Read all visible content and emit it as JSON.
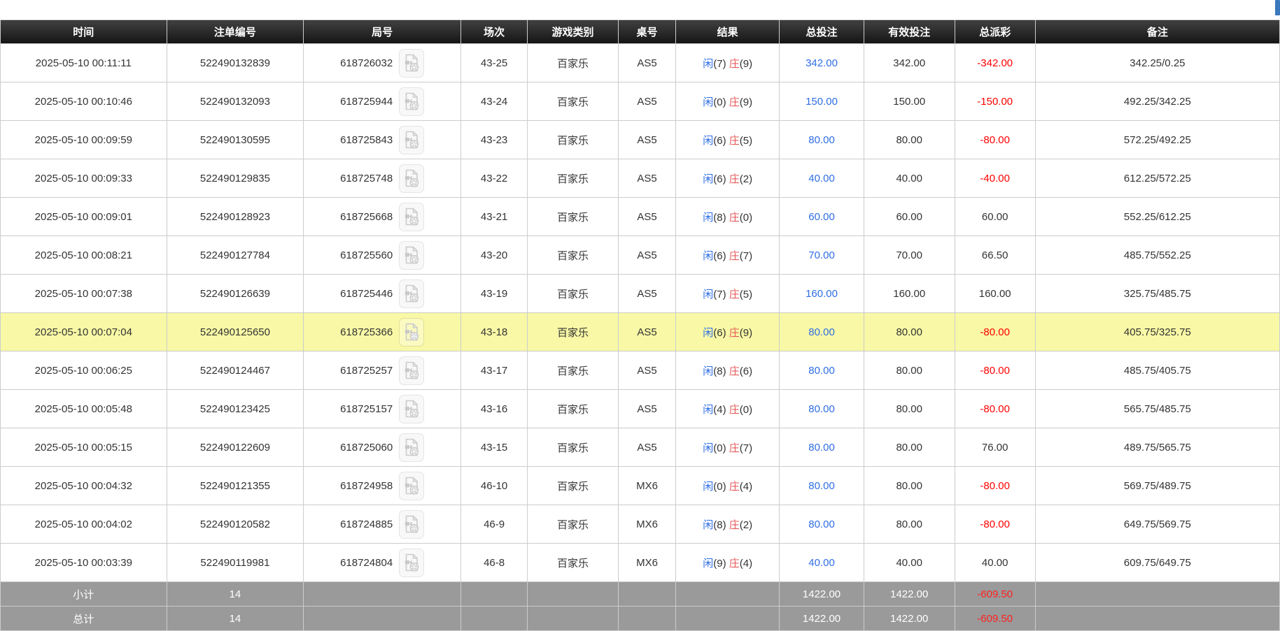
{
  "page": {
    "scrollbar_thumb_color": "#3a79bd",
    "highlight_color": "#f8f8a6",
    "header_bg": "#1a1a1a",
    "footer_bg": "#9a9a9a",
    "blue": "#2e6ee4",
    "banker_red": "#e45b5b",
    "negative_red": "#ff0000"
  },
  "table": {
    "columns": [
      {
        "id": "time",
        "label": "时间"
      },
      {
        "id": "bet-id",
        "label": "注单编号"
      },
      {
        "id": "round",
        "label": "局号"
      },
      {
        "id": "session",
        "label": "场次"
      },
      {
        "id": "game-type",
        "label": "游戏类别"
      },
      {
        "id": "table-no",
        "label": "桌号"
      },
      {
        "id": "result",
        "label": "结果"
      },
      {
        "id": "total-bet",
        "label": "总投注"
      },
      {
        "id": "valid-bet",
        "label": "有效投注"
      },
      {
        "id": "payout",
        "label": "总派彩"
      },
      {
        "id": "remark",
        "label": "备注"
      }
    ],
    "result_labels": {
      "player": "闲",
      "banker": "庄"
    },
    "icon": "video-replay-icon",
    "rows": [
      {
        "time": "2025-05-10 00:11:11",
        "bet_id": "522490132839",
        "round": "618726032",
        "session": "43-25",
        "game": "百家乐",
        "table": "AS5",
        "player": "7",
        "banker": "9",
        "total_bet": "342.00",
        "valid_bet": "342.00",
        "payout": "-342.00",
        "remark": "342.25/0.25",
        "highlighted": false
      },
      {
        "time": "2025-05-10 00:10:46",
        "bet_id": "522490132093",
        "round": "618725944",
        "session": "43-24",
        "game": "百家乐",
        "table": "AS5",
        "player": "0",
        "banker": "9",
        "total_bet": "150.00",
        "valid_bet": "150.00",
        "payout": "-150.00",
        "remark": "492.25/342.25",
        "highlighted": false
      },
      {
        "time": "2025-05-10 00:09:59",
        "bet_id": "522490130595",
        "round": "618725843",
        "session": "43-23",
        "game": "百家乐",
        "table": "AS5",
        "player": "6",
        "banker": "5",
        "total_bet": "80.00",
        "valid_bet": "80.00",
        "payout": "-80.00",
        "remark": "572.25/492.25",
        "highlighted": false
      },
      {
        "time": "2025-05-10 00:09:33",
        "bet_id": "522490129835",
        "round": "618725748",
        "session": "43-22",
        "game": "百家乐",
        "table": "AS5",
        "player": "6",
        "banker": "2",
        "total_bet": "40.00",
        "valid_bet": "40.00",
        "payout": "-40.00",
        "remark": "612.25/572.25",
        "highlighted": false
      },
      {
        "time": "2025-05-10 00:09:01",
        "bet_id": "522490128923",
        "round": "618725668",
        "session": "43-21",
        "game": "百家乐",
        "table": "AS5",
        "player": "8",
        "banker": "0",
        "total_bet": "60.00",
        "valid_bet": "60.00",
        "payout": "60.00",
        "remark": "552.25/612.25",
        "highlighted": false
      },
      {
        "time": "2025-05-10 00:08:21",
        "bet_id": "522490127784",
        "round": "618725560",
        "session": "43-20",
        "game": "百家乐",
        "table": "AS5",
        "player": "6",
        "banker": "7",
        "total_bet": "70.00",
        "valid_bet": "70.00",
        "payout": "66.50",
        "remark": "485.75/552.25",
        "highlighted": false
      },
      {
        "time": "2025-05-10 00:07:38",
        "bet_id": "522490126639",
        "round": "618725446",
        "session": "43-19",
        "game": "百家乐",
        "table": "AS5",
        "player": "7",
        "banker": "5",
        "total_bet": "160.00",
        "valid_bet": "160.00",
        "payout": "160.00",
        "remark": "325.75/485.75",
        "highlighted": false
      },
      {
        "time": "2025-05-10 00:07:04",
        "bet_id": "522490125650",
        "round": "618725366",
        "session": "43-18",
        "game": "百家乐",
        "table": "AS5",
        "player": "6",
        "banker": "9",
        "total_bet": "80.00",
        "valid_bet": "80.00",
        "payout": "-80.00",
        "remark": "405.75/325.75",
        "highlighted": true
      },
      {
        "time": "2025-05-10 00:06:25",
        "bet_id": "522490124467",
        "round": "618725257",
        "session": "43-17",
        "game": "百家乐",
        "table": "AS5",
        "player": "8",
        "banker": "6",
        "total_bet": "80.00",
        "valid_bet": "80.00",
        "payout": "-80.00",
        "remark": "485.75/405.75",
        "highlighted": false
      },
      {
        "time": "2025-05-10 00:05:48",
        "bet_id": "522490123425",
        "round": "618725157",
        "session": "43-16",
        "game": "百家乐",
        "table": "AS5",
        "player": "4",
        "banker": "0",
        "total_bet": "80.00",
        "valid_bet": "80.00",
        "payout": "-80.00",
        "remark": "565.75/485.75",
        "highlighted": false
      },
      {
        "time": "2025-05-10 00:05:15",
        "bet_id": "522490122609",
        "round": "618725060",
        "session": "43-15",
        "game": "百家乐",
        "table": "AS5",
        "player": "0",
        "banker": "7",
        "total_bet": "80.00",
        "valid_bet": "80.00",
        "payout": "76.00",
        "remark": "489.75/565.75",
        "highlighted": false
      },
      {
        "time": "2025-05-10 00:04:32",
        "bet_id": "522490121355",
        "round": "618724958",
        "session": "46-10",
        "game": "百家乐",
        "table": "MX6",
        "player": "0",
        "banker": "4",
        "total_bet": "80.00",
        "valid_bet": "80.00",
        "payout": "-80.00",
        "remark": "569.75/489.75",
        "highlighted": false
      },
      {
        "time": "2025-05-10 00:04:02",
        "bet_id": "522490120582",
        "round": "618724885",
        "session": "46-9",
        "game": "百家乐",
        "table": "MX6",
        "player": "8",
        "banker": "2",
        "total_bet": "80.00",
        "valid_bet": "80.00",
        "payout": "-80.00",
        "remark": "649.75/569.75",
        "highlighted": false
      },
      {
        "time": "2025-05-10 00:03:39",
        "bet_id": "522490119981",
        "round": "618724804",
        "session": "46-8",
        "game": "百家乐",
        "table": "MX6",
        "player": "9",
        "banker": "4",
        "total_bet": "40.00",
        "valid_bet": "40.00",
        "payout": "40.00",
        "remark": "609.75/649.75",
        "highlighted": false
      }
    ],
    "footer": [
      {
        "id": "subtotal",
        "label": "小计",
        "count": "14",
        "total_bet": "1422.00",
        "valid_bet": "1422.00",
        "payout": "-609.50"
      },
      {
        "id": "total",
        "label": "总计",
        "count": "14",
        "total_bet": "1422.00",
        "valid_bet": "1422.00",
        "payout": "-609.50"
      }
    ]
  }
}
